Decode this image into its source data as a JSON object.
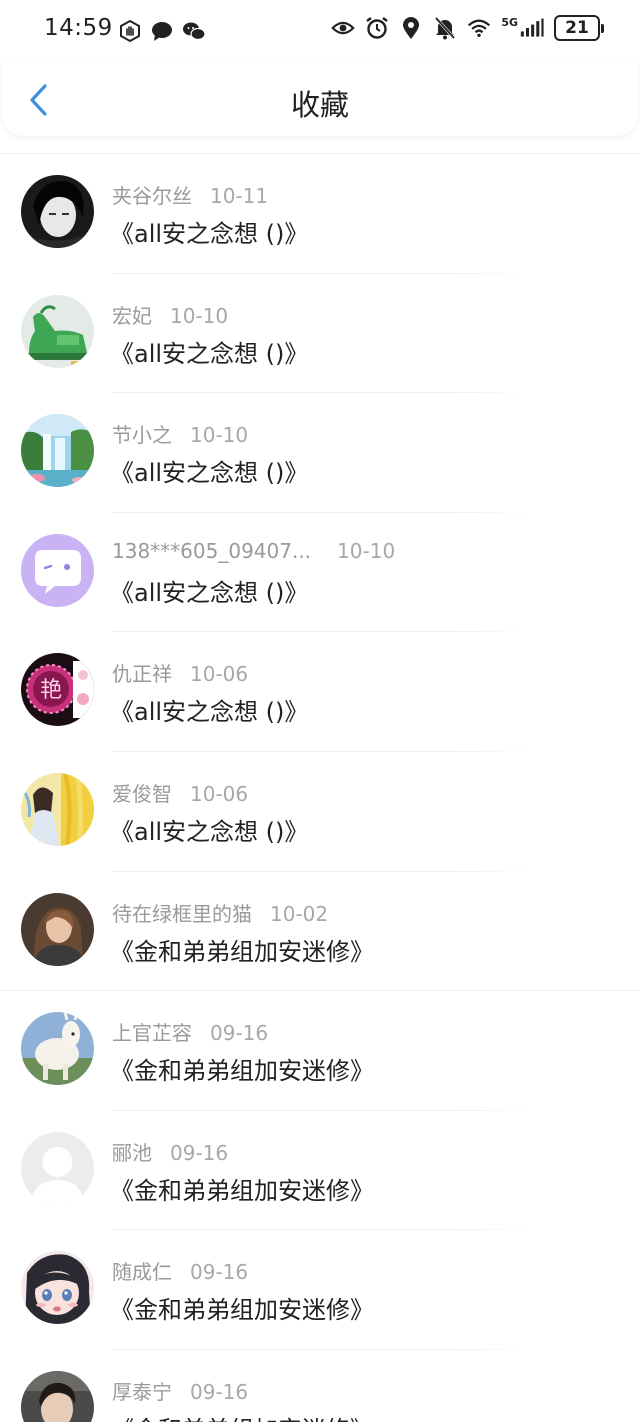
{
  "status_bar": {
    "time": "14:59",
    "network": "5G",
    "battery": "21",
    "left_icons": [
      "hand-shield-icon",
      "chat-bubble-icon",
      "wechat-icon"
    ],
    "right_icons": [
      "eye-icon",
      "alarm-icon",
      "location-icon",
      "bell-off-icon",
      "wifi-icon",
      "signal-icon",
      "battery-icon"
    ]
  },
  "header": {
    "title": "收藏",
    "back_icon": "chevron-left-icon",
    "accent_color": "#3d8fe0"
  },
  "items": [
    {
      "user": "夹谷尔丝",
      "date": "10-11",
      "title": "《all安之念想 ()》",
      "avatar": "dark-portrait"
    },
    {
      "user": "宏妃",
      "date": "10-10",
      "title": "《all安之念想 ()》",
      "avatar": "green-jade"
    },
    {
      "user": "节小之",
      "date": "10-10",
      "title": "《all安之念想 ()》",
      "avatar": "waterfall"
    },
    {
      "user": "138***605_09407...",
      "date": "10-10",
      "title": "《all安之念想 ()》",
      "avatar": "purple-chat"
    },
    {
      "user": "仇正祥",
      "date": "10-06",
      "title": "《all安之念想 ()》",
      "avatar": "pink-neon"
    },
    {
      "user": "爱俊智",
      "date": "10-06",
      "title": "《all安之念想 ()》",
      "avatar": "yellow-anime"
    },
    {
      "user": "待在绿框里的猫",
      "date": "10-02",
      "title": "《金和弟弟组加安迷修》",
      "avatar": "girl-portrait"
    },
    {
      "user": "上官芷容",
      "date": "09-16",
      "title": "《金和弟弟组加安迷修》",
      "avatar": "alpaca"
    },
    {
      "user": "郦池",
      "date": "09-16",
      "title": "《金和弟弟组加安迷修》",
      "avatar": "default-user"
    },
    {
      "user": "随成仁",
      "date": "09-16",
      "title": "《金和弟弟组加安迷修》",
      "avatar": "anime-girl"
    },
    {
      "user": "厚泰宁",
      "date": "09-16",
      "title": "《金和弟弟组加安迷修》",
      "avatar": "boy-portrait"
    }
  ]
}
